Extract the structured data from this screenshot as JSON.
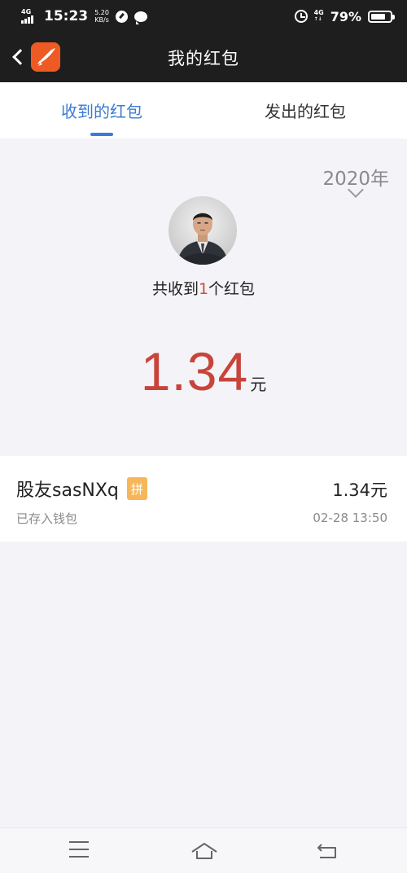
{
  "status_bar": {
    "network_tag": "4G",
    "time": "15:23",
    "net_speed_value": "5.20",
    "net_speed_unit": "KB/s",
    "network_tag_right": "4G",
    "battery_percent": "79%",
    "battery_level": 0.79
  },
  "nav": {
    "title": "我的红包",
    "back_icon": "chevron-left-icon",
    "logo_icon": "app-logo-icon",
    "logo_color": "#ee5a24"
  },
  "tabs": [
    {
      "label": "收到的红包",
      "active": true
    },
    {
      "label": "发出的红包",
      "active": false
    }
  ],
  "summary": {
    "year": "2020年",
    "text_prefix": "共收到",
    "count": "1",
    "text_suffix": "个红包",
    "amount": "1.34",
    "amount_unit": "元"
  },
  "records": [
    {
      "name": "股友sasNXq",
      "badge": "拼",
      "amount": "1.34元",
      "status": "已存入钱包",
      "time": "02-28 13:50"
    }
  ],
  "colors": {
    "accent_blue": "#3a7bd5",
    "amount_red": "#c8443a",
    "badge_orange": "#f5b759",
    "bar_dark": "#1e1e1e"
  },
  "bottom_nav": {
    "menu_icon": "menu-icon",
    "home_icon": "home-icon",
    "back_icon": "back-icon"
  }
}
